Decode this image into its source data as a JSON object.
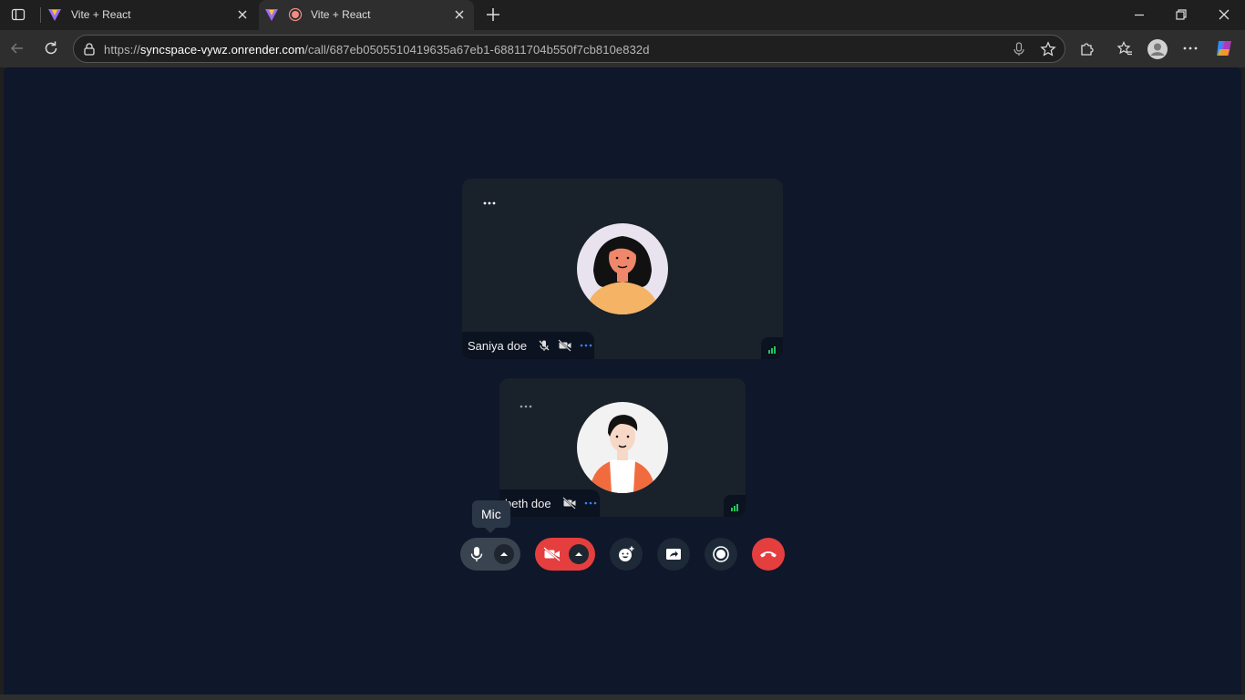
{
  "tabs": [
    {
      "title": "Vite + React"
    },
    {
      "title": "Vite + React"
    }
  ],
  "address": {
    "url_prefix": "https://",
    "url_host": "syncspace-vywz.onrender.com",
    "url_path": "/call/687eb0505510419635a67eb1-68811704b550f7cb810e832d"
  },
  "participants": [
    {
      "name": "Saniya doe"
    },
    {
      "name": "beth doe"
    }
  ],
  "controls": {
    "tooltip": "Mic"
  },
  "colors": {
    "page_bg": "#0f172a",
    "tile_bg": "#19212a",
    "danger": "#e53e3e",
    "signal": "#22c55e",
    "dots_accent": "#3b82f6"
  }
}
